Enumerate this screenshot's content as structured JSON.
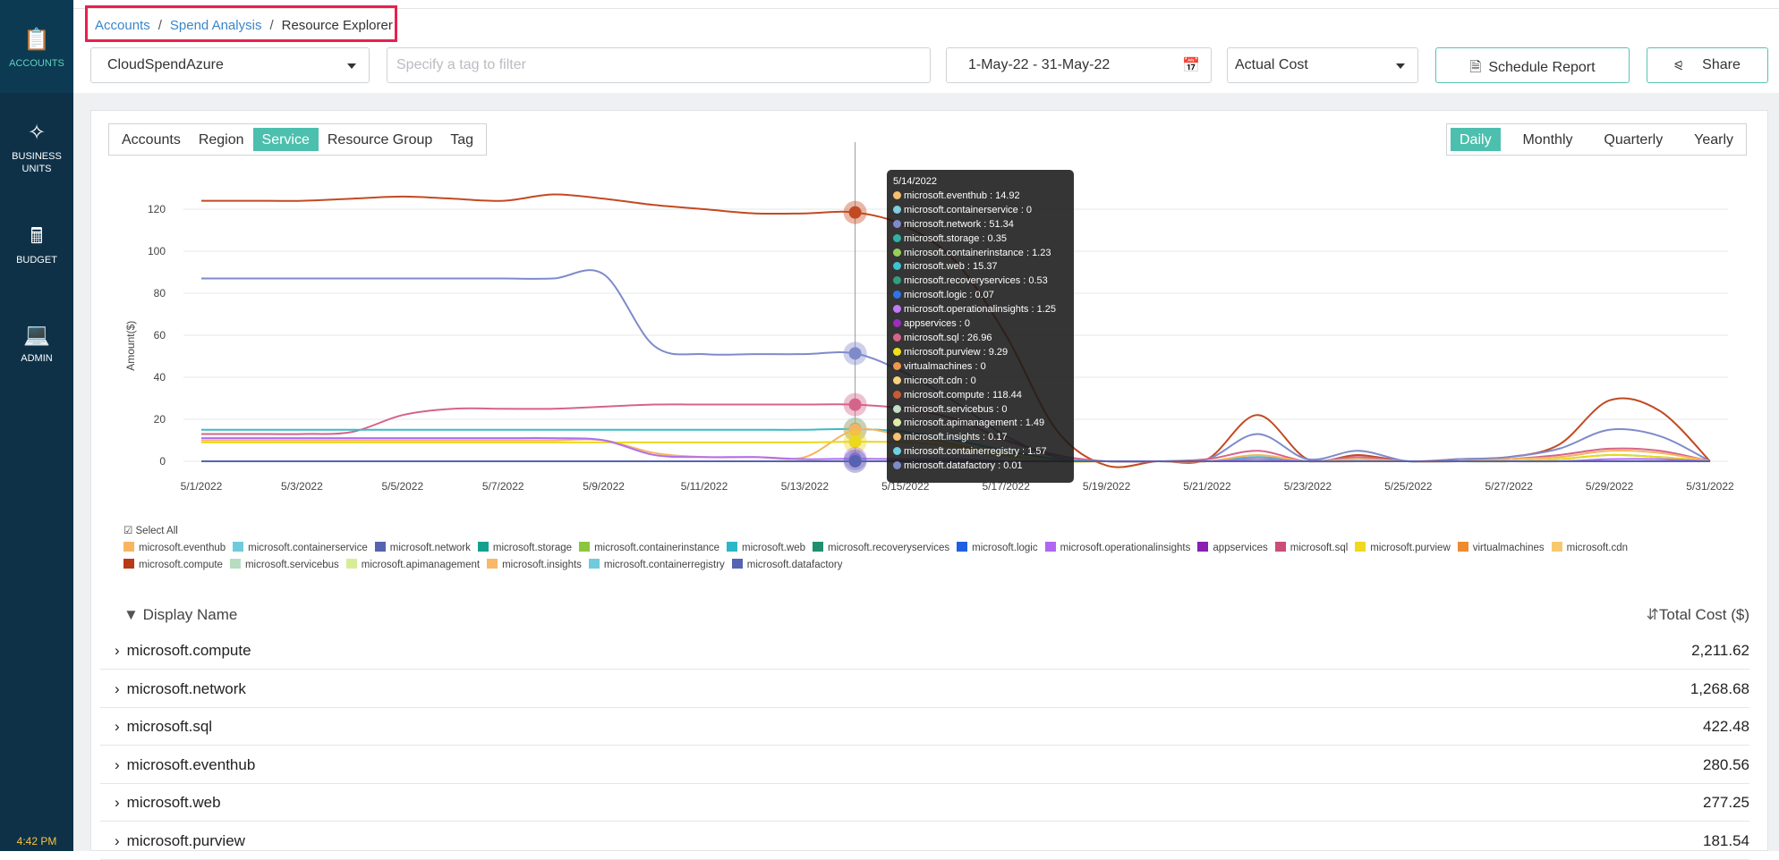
{
  "sidebar": {
    "items": [
      {
        "label": "ACCOUNTS",
        "icon": "accounts-icon",
        "active": true
      },
      {
        "label": "BUSINESS UNITS",
        "icon": "business-units-icon"
      },
      {
        "label": "BUDGET",
        "icon": "budget-icon"
      },
      {
        "label": "ADMIN",
        "icon": "admin-icon"
      }
    ],
    "time": "4:42 PM"
  },
  "breadcrumb": {
    "items": [
      "Accounts",
      "Spend Analysis",
      "Resource Explorer"
    ],
    "separator": "/"
  },
  "toolbar": {
    "account": "CloudSpendAzure",
    "tag_placeholder": "Specify a tag to filter",
    "date_range": "1-May-22 - 31-May-22",
    "cost_type": "Actual Cost",
    "schedule": "Schedule Report",
    "share": "Share"
  },
  "group_tabs": [
    {
      "label": "Accounts"
    },
    {
      "label": "Region"
    },
    {
      "label": "Service",
      "active": true
    },
    {
      "label": "Resource Group"
    },
    {
      "label": "Tag"
    }
  ],
  "period_tabs": [
    {
      "label": "Daily",
      "active": true
    },
    {
      "label": "Monthly"
    },
    {
      "label": "Quarterly"
    },
    {
      "label": "Yearly"
    }
  ],
  "chart_data": {
    "type": "line",
    "ylabel": "Amount($)",
    "ylim": [
      -5,
      130
    ],
    "yticks": [
      0,
      20,
      40,
      60,
      80,
      100,
      120
    ],
    "xticks": [
      "5/1/2022",
      "5/3/2022",
      "5/5/2022",
      "5/7/2022",
      "5/9/2022",
      "5/11/2022",
      "5/13/2022",
      "5/15/2022",
      "5/17/2022",
      "5/19/2022",
      "5/21/2022",
      "5/23/2022",
      "5/25/2022",
      "5/27/2022",
      "5/29/2022",
      "5/31/2022"
    ],
    "x_days": [
      1,
      31
    ],
    "grid": true,
    "series": [
      {
        "name": "microsoft.compute",
        "color": "#c24a22",
        "values": [
          124,
          124,
          124,
          125,
          126,
          125,
          124,
          127,
          125,
          122,
          120,
          118,
          118,
          118.44,
          112,
          95,
          60,
          15,
          -2,
          0,
          1,
          22,
          1,
          3,
          0,
          1,
          2,
          8,
          29,
          24,
          0
        ]
      },
      {
        "name": "microsoft.network",
        "color": "#7f8acb",
        "values": [
          87,
          87,
          87,
          87,
          87,
          87,
          87,
          87,
          89,
          55,
          51,
          51,
          51,
          51.34,
          42,
          28,
          12,
          2,
          0,
          0,
          1,
          13,
          1,
          5,
          0,
          1,
          2,
          6,
          15,
          12,
          0
        ]
      },
      {
        "name": "microsoft.sql",
        "color": "#d5648a",
        "values": [
          13,
          13,
          13,
          14,
          22,
          25,
          25,
          25,
          26,
          27,
          27,
          27,
          27,
          26.96,
          25,
          20,
          10,
          3,
          0,
          0,
          1,
          5,
          0,
          2,
          0,
          0,
          1,
          3,
          6,
          5,
          0
        ]
      },
      {
        "name": "microsoft.web",
        "color": "#3cbac6",
        "values": [
          15,
          15,
          15,
          15,
          15,
          15,
          15,
          15,
          15,
          15,
          15,
          15,
          15,
          15.37,
          14,
          10,
          5,
          1,
          0,
          0,
          0,
          2,
          0,
          1,
          0,
          0,
          0,
          1,
          3,
          2,
          0
        ]
      },
      {
        "name": "microsoft.eventhub",
        "color": "#f5b45f",
        "values": [
          10,
          10,
          10,
          10,
          10,
          10,
          10,
          10,
          10,
          4,
          2,
          2,
          2,
          14.92,
          12,
          8,
          3,
          0,
          0,
          0,
          0,
          3,
          0,
          1,
          0,
          0,
          1,
          2,
          5,
          4,
          0
        ]
      },
      {
        "name": "microsoft.purview",
        "color": "#ecd81c",
        "values": [
          9,
          9,
          9,
          9,
          9,
          9,
          9,
          9,
          9,
          9,
          9,
          9,
          9,
          9.29,
          9,
          7,
          3,
          0,
          0,
          0,
          0,
          1,
          0,
          0,
          0,
          0,
          0,
          1,
          3,
          2,
          0
        ]
      },
      {
        "name": "microsoft.operationalinsights",
        "color": "#b06ef0",
        "values": [
          11,
          11,
          11,
          11,
          11,
          11,
          11,
          11,
          10,
          3,
          2,
          2,
          1,
          1.25,
          1,
          1,
          0,
          0,
          0,
          0,
          0,
          1,
          0,
          0,
          0,
          0,
          0,
          0,
          1,
          1,
          0
        ]
      },
      {
        "name": "microsoft.datafactory",
        "color": "#5663b0",
        "values": [
          0,
          0,
          0,
          0,
          0,
          0,
          0,
          0,
          0,
          0,
          0,
          0,
          0,
          0.01,
          0,
          0,
          0,
          0,
          0,
          0,
          0,
          0,
          0,
          0,
          0,
          0,
          0,
          0,
          0,
          0,
          0
        ]
      }
    ],
    "hover_day": 14,
    "tooltip": {
      "title": "5/14/2022",
      "items": [
        {
          "label": "microsoft.eventhub : 14.92",
          "color": "#f5c06e"
        },
        {
          "label": "microsoft.containerservice : 0",
          "color": "#7fcfe0"
        },
        {
          "label": "microsoft.network : 51.34",
          "color": "#7f8acb"
        },
        {
          "label": "microsoft.storage : 0.35",
          "color": "#2fb2a3"
        },
        {
          "label": "microsoft.containerinstance : 1.23",
          "color": "#98cf58"
        },
        {
          "label": "microsoft.web : 15.37",
          "color": "#3cc4d0"
        },
        {
          "label": "microsoft.recoveryservices : 0.53",
          "color": "#2f9f80"
        },
        {
          "label": "microsoft.logic : 0.07",
          "color": "#2f72f0"
        },
        {
          "label": "microsoft.operationalinsights : 1.25",
          "color": "#c07af5"
        },
        {
          "label": "appservices : 0",
          "color": "#9b2dc0"
        },
        {
          "label": "microsoft.sql : 26.96",
          "color": "#d5648a"
        },
        {
          "label": "microsoft.purview : 9.29",
          "color": "#f0e01a"
        },
        {
          "label": "virtualmachines : 0",
          "color": "#f0964a"
        },
        {
          "label": "microsoft.cdn : 0",
          "color": "#f8d080"
        },
        {
          "label": "microsoft.compute : 118.44",
          "color": "#c95a34"
        },
        {
          "label": "microsoft.servicebus : 0",
          "color": "#c0e0c8"
        },
        {
          "label": "microsoft.apimanagement : 1.49",
          "color": "#dcedaa"
        },
        {
          "label": "microsoft.insights : 0.17",
          "color": "#f8c070"
        },
        {
          "label": "microsoft.containerregistry : 1.57",
          "color": "#6fd0e0"
        },
        {
          "label": "microsoft.datafactory : 0.01",
          "color": "#7f8acb"
        }
      ]
    }
  },
  "legend": {
    "select_all": "Select All",
    "rows": [
      [
        {
          "label": "microsoft.eventhub",
          "color": "#f7b560"
        },
        {
          "label": "microsoft.containerservice",
          "color": "#6fcbdc"
        },
        {
          "label": "microsoft.network",
          "color": "#5663b0"
        },
        {
          "label": "microsoft.storage",
          "color": "#14a08f"
        },
        {
          "label": "microsoft.containerinstance",
          "color": "#8cc63f"
        },
        {
          "label": "microsoft.web",
          "color": "#2bb7c8"
        },
        {
          "label": "microsoft.recoveryservices",
          "color": "#1f8f6f"
        },
        {
          "label": "microsoft.logic",
          "color": "#2060e0"
        },
        {
          "label": "microsoft.operationalinsights",
          "color": "#b066f0"
        },
        {
          "label": "appservices",
          "color": "#8a1fb0"
        },
        {
          "label": "microsoft.sql",
          "color": "#cc4d77"
        },
        {
          "label": "microsoft.purview",
          "color": "#f0d820"
        },
        {
          "label": "virtualmachines",
          "color": "#f08a30"
        },
        {
          "label": "microsoft.cdn",
          "color": "#f8c870"
        }
      ],
      [
        {
          "label": "microsoft.compute",
          "color": "#b83a18"
        },
        {
          "label": "microsoft.servicebus",
          "color": "#b8dcc0"
        },
        {
          "label": "microsoft.apimanagement",
          "color": "#d8ec98"
        },
        {
          "label": "microsoft.insights",
          "color": "#f8b868"
        },
        {
          "label": "microsoft.containerregistry",
          "color": "#6fcbdc"
        },
        {
          "label": "microsoft.datafactory",
          "color": "#5663b0"
        }
      ]
    ]
  },
  "table": {
    "col_name": "Display Name",
    "col_cost": "Total Cost ($)",
    "rows": [
      {
        "name": "microsoft.compute",
        "cost": "2,211.62"
      },
      {
        "name": "microsoft.network",
        "cost": "1,268.68"
      },
      {
        "name": "microsoft.sql",
        "cost": "422.48"
      },
      {
        "name": "microsoft.eventhub",
        "cost": "280.56"
      },
      {
        "name": "microsoft.web",
        "cost": "277.25"
      },
      {
        "name": "microsoft.purview",
        "cost": "181.54"
      }
    ]
  }
}
